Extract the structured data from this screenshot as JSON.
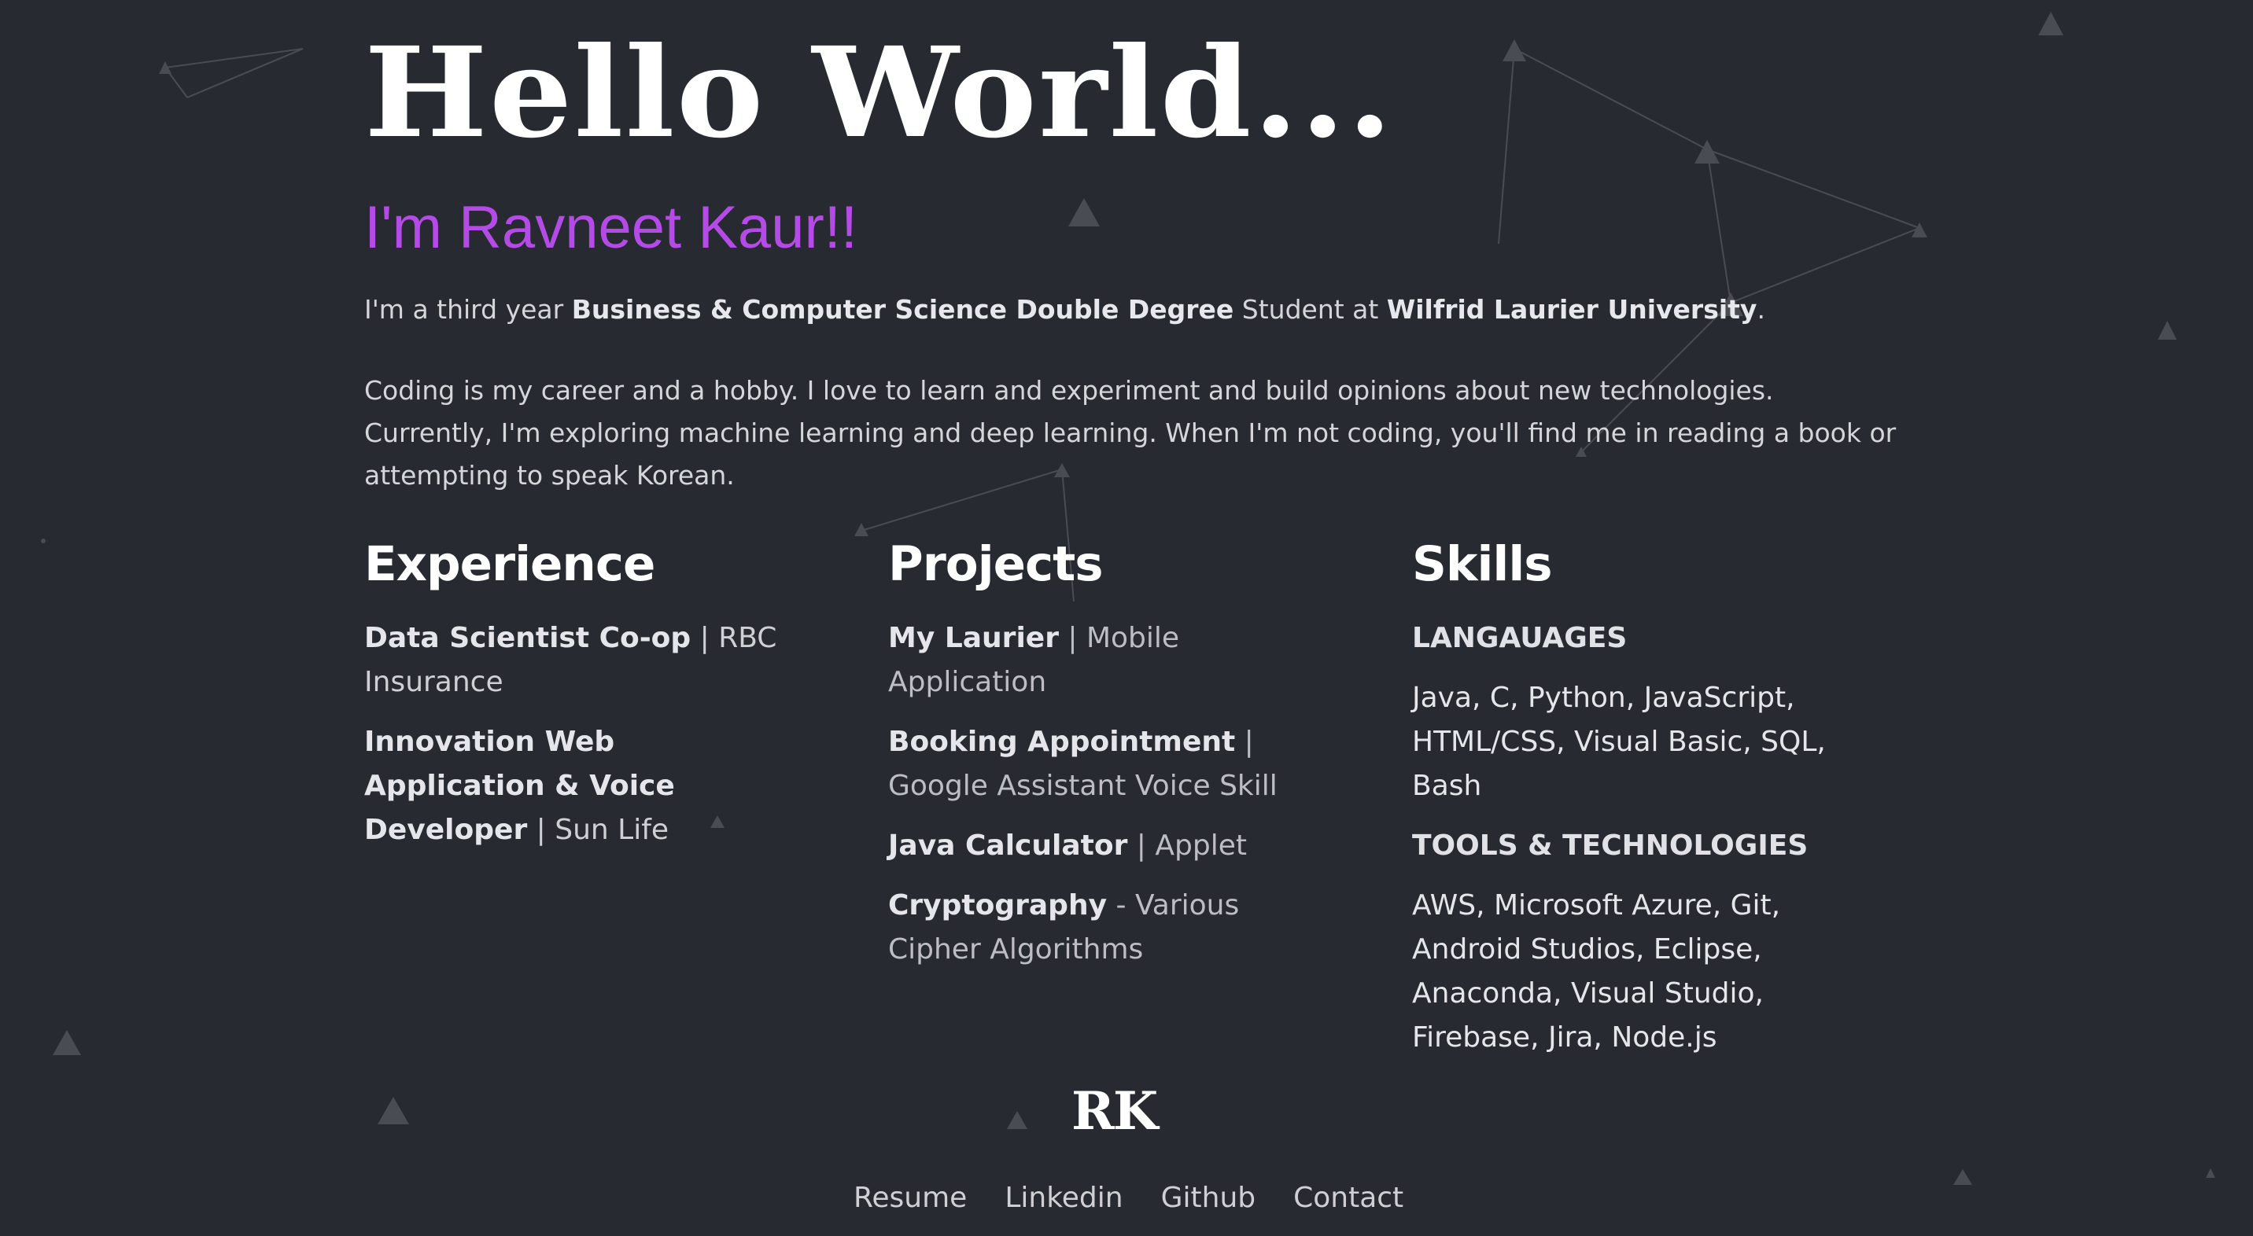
{
  "hero": {
    "greeting": "Hello World...",
    "name": "I'm Ravneet Kaur!!"
  },
  "intro": {
    "text_1": "I'm a third year ",
    "degree": "Business & Computer Science Double Degree",
    "text_2": " Student at ",
    "university": "Wilfrid Laurier University",
    "text_3": "."
  },
  "about": "Coding is my career and a hobby. I love to learn and experiment and build opinions about new technologies. Currently, I'm exploring machine learning and deep learning. When I'm not coding, you'll find me in reading a book or attempting to speak Korean.",
  "experience": {
    "heading": "Experience",
    "items": [
      {
        "title": "Data Scientist Co-op",
        "sep": " | ",
        "org": "RBC Insurance"
      },
      {
        "title": "Innovation Web Application & Voice Developer",
        "sep": " | ",
        "org": "Sun Life"
      }
    ]
  },
  "projects": {
    "heading": "Projects",
    "items": [
      {
        "title": "My Laurier",
        "sep": " | ",
        "desc": "Mobile Application"
      },
      {
        "title": "Booking Appointment",
        "sep": " | ",
        "desc": "Google Assistant Voice Skill"
      },
      {
        "title": "Java Calculator",
        "sep": " | ",
        "desc": "Applet"
      },
      {
        "title": "Cryptography",
        "sep": " - ",
        "desc": "Various Cipher Algorithms"
      }
    ]
  },
  "skills": {
    "heading": "Skills",
    "languages_label": "LANGAUAGES",
    "languages": "Java, C, Python, JavaScript, HTML/CSS, Visual Basic, SQL, Bash",
    "tools_label": "TOOLS & TECHNOLOGIES",
    "tools": "AWS, Microsoft Azure, Git, Android Studios, Eclipse, Anaconda, Visual Studio, Firebase, Jira, Node.js"
  },
  "footer": {
    "logo": "RK",
    "links": [
      "Resume",
      "Linkedin",
      "Github",
      "Contact"
    ]
  },
  "colors": {
    "background": "#282a32",
    "accent": "#b44be6",
    "particle": "#4a4c54"
  }
}
